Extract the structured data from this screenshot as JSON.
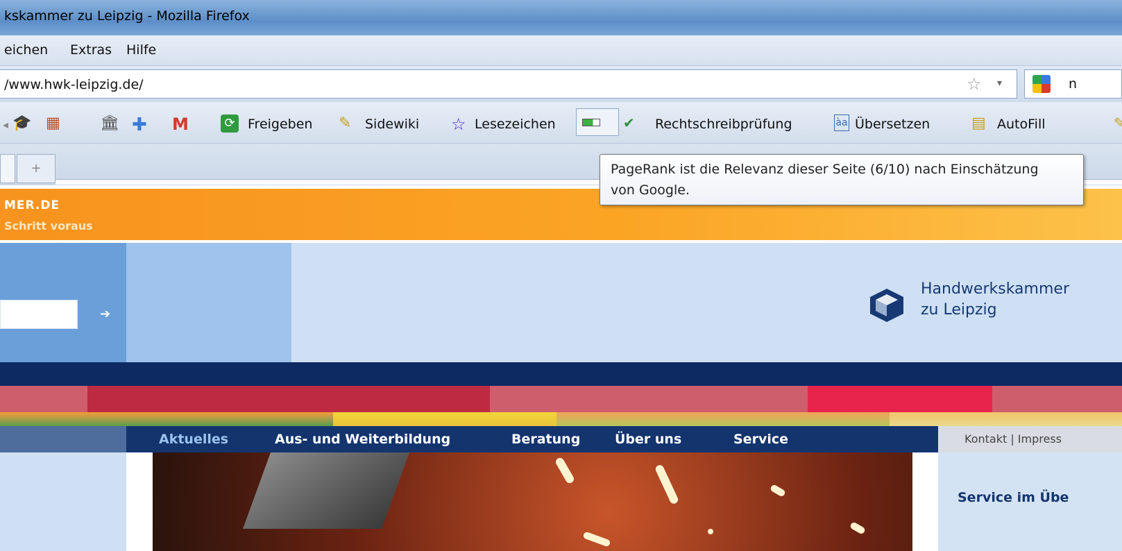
{
  "window": {
    "title": "kskammer zu Leipzig - Mozilla Firefox"
  },
  "menubar": {
    "items": [
      "eichen",
      "Extras",
      "Hilfe"
    ]
  },
  "navbar": {
    "url": "/www.hwk-leipzig.de/",
    "search_text": "n"
  },
  "toolbar": {
    "freigeben": "Freigeben",
    "sidewiki": "Sidewiki",
    "lesezeichen": "Lesezeichen",
    "rechtschreib": "Rechtschreibprüfung",
    "uebersetzen": "Übersetzen",
    "autofill": "AutoFill",
    "pagerank": 0.6
  },
  "tabs": {
    "new_tab": "+"
  },
  "tooltip": {
    "line1": "PageRank ist die Relevanz dieser Seite (6/10) nach Einschätzung",
    "line2": "von Google."
  },
  "site": {
    "banner_line1": "MER.DE",
    "banner_line2": "Schritt voraus",
    "search_arrow": "➔",
    "logo_line1": "Handwerkskammer",
    "logo_line2": "zu Leipzig",
    "nav": [
      "Aktuelles",
      "Aus- und Weiterbildung",
      "Beratung",
      "Über uns",
      "Service"
    ],
    "meta_links": "Kontakt | Impress",
    "right_title": "Service im Übe"
  },
  "colors": {
    "accent_orange": "#f7931e",
    "navy": "#0e2a63",
    "nav_blue": "#14346e",
    "nav_active": "#9cc3ee"
  }
}
